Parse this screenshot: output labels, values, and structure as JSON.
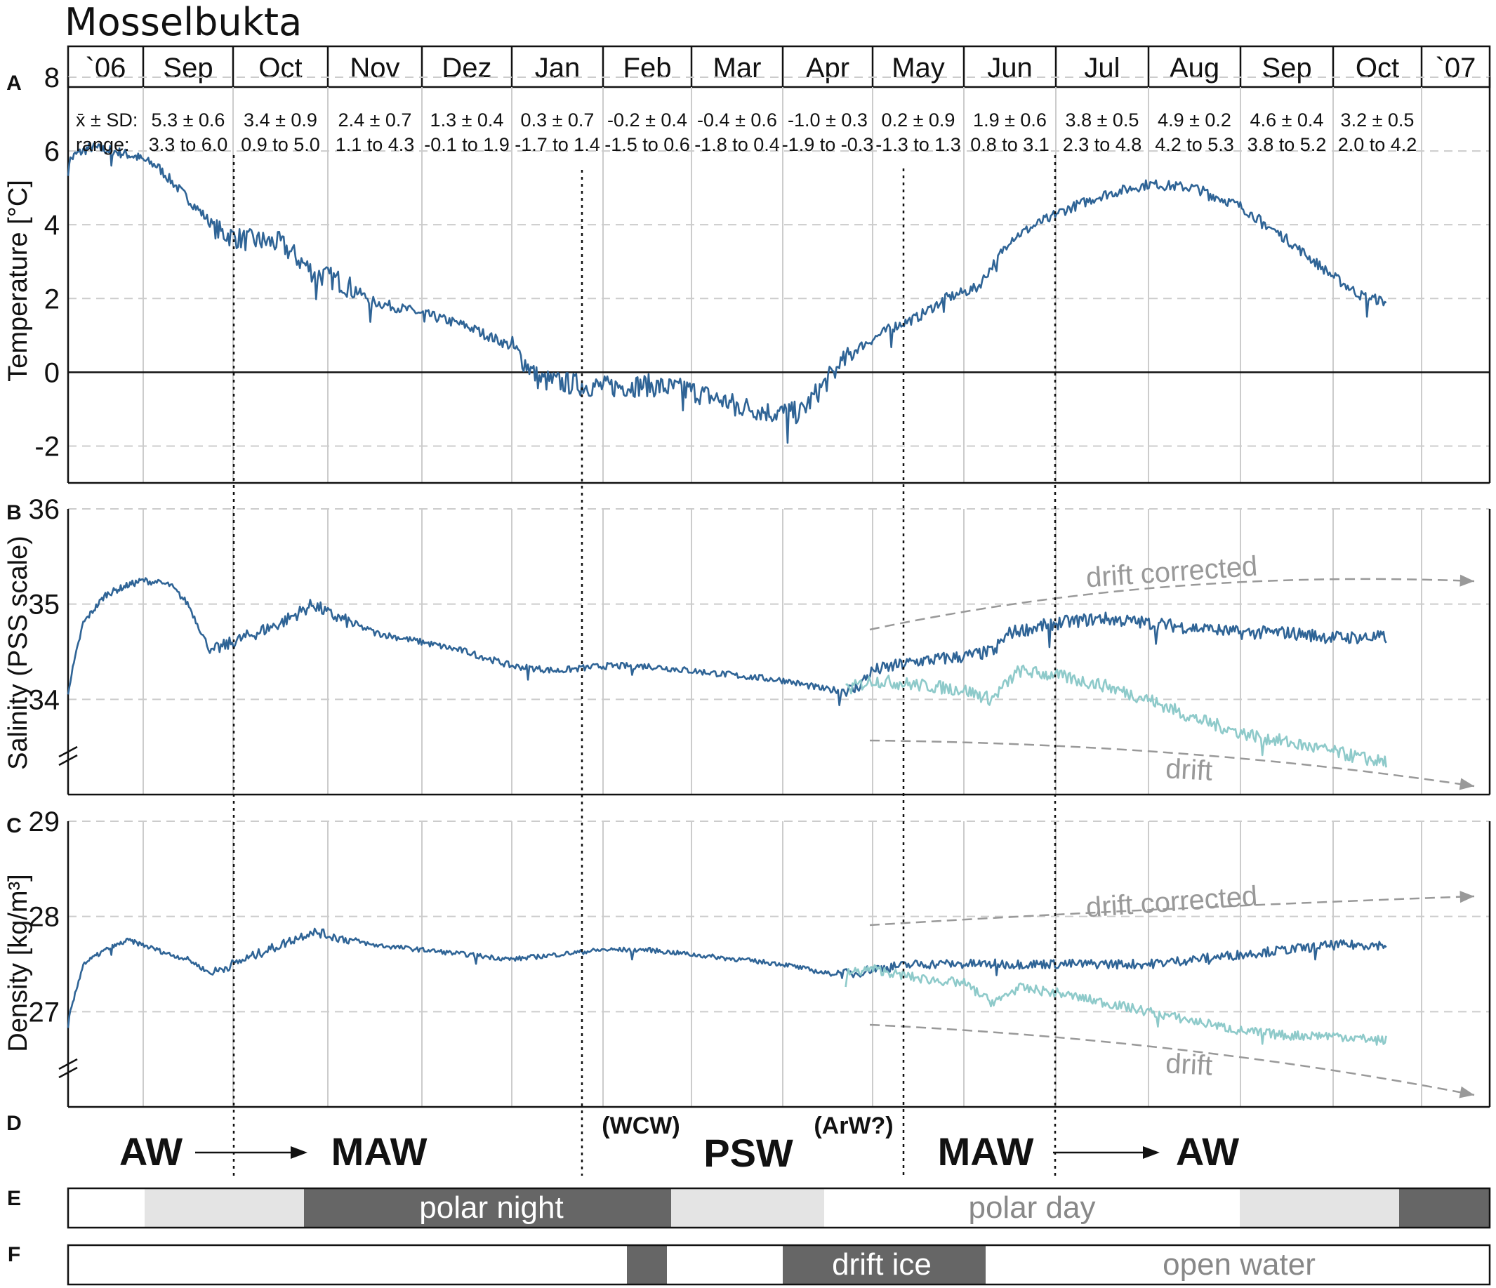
{
  "title": "Mosselbukta",
  "months": [
    "`06",
    "Sep",
    "Oct",
    "Nov",
    "Dez",
    "Jan",
    "Feb",
    "Mar",
    "Apr",
    "May",
    "Jun",
    "Jul",
    "Aug",
    "Sep",
    "Oct",
    "`07"
  ],
  "stats_labels": {
    "mean": "x̄ ± SD:",
    "range": "range:"
  },
  "stats": [
    {
      "mean": "5.3 ± 0.6",
      "range": "3.3 to 6.0"
    },
    {
      "mean": "3.4 ± 0.9",
      "range": "0.9 to 5.0"
    },
    {
      "mean": "2.4 ± 0.7",
      "range": "1.1 to 4.3"
    },
    {
      "mean": "1.3 ± 0.4",
      "range": "-0.1 to 1.9"
    },
    {
      "mean": "0.3 ± 0.7",
      "range": "-1.7 to 1.4"
    },
    {
      "mean": "-0.2 ± 0.4",
      "range": "-1.5 to 0.6"
    },
    {
      "mean": "-0.4 ± 0.6",
      "range": "-1.8 to 0.4"
    },
    {
      "mean": "-1.0 ± 0.3",
      "range": "-1.9 to -0.3"
    },
    {
      "mean": "0.2 ± 0.9",
      "range": "-1.3 to 1.3"
    },
    {
      "mean": "1.9 ± 0.6",
      "range": "0.8 to 3.1"
    },
    {
      "mean": "3.8 ± 0.5",
      "range": "2.3 to 4.8"
    },
    {
      "mean": "4.9 ± 0.2",
      "range": "4.2 to 5.3"
    },
    {
      "mean": "4.6 ± 0.4",
      "range": "3.8 to 5.2"
    },
    {
      "mean": "3.2 ± 0.5",
      "range": "2.0 to 4.2"
    }
  ],
  "panel_letters": [
    "A",
    "B",
    "C",
    "D",
    "E",
    "F"
  ],
  "colors": {
    "main": "#2f6496",
    "drift": "#8ecaca",
    "annot": "#999999",
    "dark_bar": "#666666",
    "light_bar": "#e4e4e4"
  },
  "chart_data": [
    {
      "panel": "A",
      "type": "line",
      "ylabel": "Temperature [°C]",
      "ylim": [
        -3,
        8
      ],
      "yticks": [
        -2,
        0,
        2,
        4,
        6,
        8
      ],
      "series": [
        {
          "x": [
            0,
            0.1,
            0.3,
            0.6,
            0.9,
            1.15,
            1.5,
            1.85,
            2.1,
            2.5,
            2.85,
            3.1,
            3.5,
            4.0,
            4.5,
            5.0,
            5.3,
            5.6,
            6.0,
            6.5,
            7.0,
            7.5,
            7.9,
            8.2,
            8.5,
            8.8,
            9.2,
            9.5,
            9.8,
            10.15,
            10.5,
            11.0,
            11.5,
            12.0,
            12.5,
            13.0,
            13.5,
            14.0,
            14.3,
            14.6
          ],
          "y": [
            5.7,
            5.9,
            6.1,
            6.0,
            5.85,
            5.6,
            4.7,
            3.8,
            3.6,
            3.5,
            2.7,
            2.5,
            1.9,
            1.6,
            1.25,
            0.7,
            -0.2,
            -0.3,
            -0.4,
            -0.35,
            -0.5,
            -0.9,
            -1.1,
            -1.1,
            -0.2,
            0.6,
            1.2,
            1.5,
            2.0,
            2.3,
            3.6,
            4.3,
            4.8,
            5.1,
            5.0,
            4.5,
            3.6,
            2.6,
            2.1,
            1.9
          ]
        }
      ]
    },
    {
      "panel": "B",
      "type": "line",
      "ylabel": "Salinity (PSS scale)",
      "ylim": [
        33.0,
        36
      ],
      "yticks": [
        34,
        35,
        36
      ],
      "series": [
        {
          "x": [
            0,
            0.2,
            0.5,
            0.8,
            1.0,
            1.3,
            1.5,
            1.75,
            2.0,
            2.5,
            2.85,
            3.0,
            3.5,
            4.0,
            4.5,
            5.0,
            5.5,
            6.0,
            6.5,
            7.0,
            7.5,
            8.0,
            8.5,
            8.8,
            9.0,
            9.5,
            10.0,
            10.3,
            10.5,
            11.0,
            11.5,
            12.0,
            12.5,
            13.0,
            13.5,
            14.0,
            14.5,
            14.6
          ],
          "y": [
            34.1,
            34.8,
            35.1,
            35.2,
            35.25,
            35.2,
            35.0,
            34.5,
            34.6,
            34.8,
            35.0,
            34.9,
            34.7,
            34.6,
            34.5,
            34.35,
            34.3,
            34.35,
            34.35,
            34.3,
            34.25,
            34.2,
            34.1,
            34.1,
            34.3,
            34.4,
            34.45,
            34.5,
            34.7,
            34.8,
            34.85,
            34.8,
            34.75,
            34.7,
            34.7,
            34.65,
            34.65,
            34.65
          ]
        },
        {
          "x": [
            8.7,
            9.0,
            9.5,
            10.0,
            10.3,
            10.6,
            11.0,
            11.5,
            12.0,
            12.5,
            13.0,
            13.5,
            14.0,
            14.5,
            14.6
          ],
          "y": [
            34.1,
            34.2,
            34.15,
            34.1,
            34.0,
            34.3,
            34.25,
            34.15,
            34.0,
            33.8,
            33.65,
            33.55,
            33.45,
            33.35,
            33.35
          ]
        }
      ],
      "annotations": [
        "drift corrected",
        "drift"
      ]
    },
    {
      "panel": "C",
      "type": "line",
      "ylabel": "Density [kg/m³]",
      "ylim": [
        26.0,
        29
      ],
      "yticks": [
        27,
        28,
        29
      ],
      "series": [
        {
          "x": [
            0,
            0.2,
            0.5,
            0.8,
            1.0,
            1.3,
            1.5,
            1.75,
            2.0,
            2.5,
            2.85,
            3.0,
            3.5,
            4.0,
            4.5,
            5.0,
            5.5,
            6.0,
            6.5,
            7.0,
            7.5,
            8.0,
            8.5,
            8.8,
            9.0,
            9.5,
            10.0,
            10.3,
            10.5,
            11.0,
            11.5,
            12.0,
            12.5,
            13.0,
            13.5,
            14.0,
            14.5,
            14.6
          ],
          "y": [
            26.9,
            27.5,
            27.65,
            27.75,
            27.7,
            27.6,
            27.55,
            27.4,
            27.5,
            27.7,
            27.85,
            27.8,
            27.7,
            27.65,
            27.6,
            27.55,
            27.6,
            27.65,
            27.65,
            27.6,
            27.55,
            27.5,
            27.4,
            27.4,
            27.45,
            27.5,
            27.5,
            27.5,
            27.5,
            27.5,
            27.5,
            27.5,
            27.55,
            27.6,
            27.65,
            27.7,
            27.7,
            27.7
          ]
        },
        {
          "x": [
            8.7,
            9.0,
            9.5,
            10.0,
            10.3,
            10.6,
            11.0,
            11.5,
            12.0,
            12.5,
            13.0,
            13.5,
            14.0,
            14.5,
            14.6
          ],
          "y": [
            27.4,
            27.45,
            27.35,
            27.3,
            27.1,
            27.25,
            27.2,
            27.1,
            27.0,
            26.9,
            26.8,
            26.75,
            26.75,
            26.7,
            26.7
          ]
        }
      ],
      "annotations": [
        "drift corrected",
        "drift"
      ]
    }
  ],
  "water_masses": [
    {
      "label": "AW"
    },
    {
      "label": "MAW"
    },
    {
      "label": "(WCW)"
    },
    {
      "label": "PSW"
    },
    {
      "label": "(ArW?)"
    },
    {
      "label": "MAW"
    },
    {
      "label": "AW"
    }
  ],
  "light_bar": {
    "polar_night": "polar night",
    "polar_day": "polar day"
  },
  "ice_bar": {
    "drift_ice": "drift ice",
    "open_water": "open water"
  }
}
